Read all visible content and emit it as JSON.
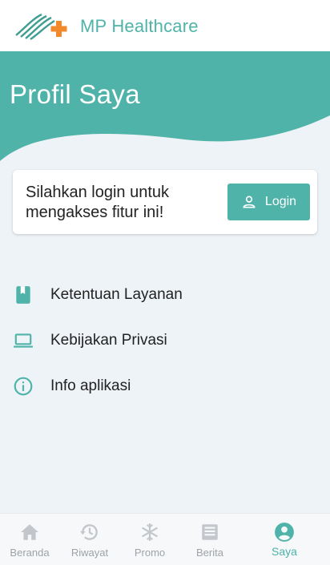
{
  "header": {
    "brand": "MP Healthcare",
    "logo_icon": "mp-healthcare-logo",
    "brand_color": "#4fb3a9",
    "cross_color": "#f28a2b"
  },
  "hero": {
    "title": "Profil Saya",
    "color": "#4fb3a9"
  },
  "login_card": {
    "message": "Silahkan login untuk mengakses fitur ini!",
    "button_label": "Login",
    "button_icon": "user-icon"
  },
  "menu": [
    {
      "label": "Ketentuan Layanan",
      "icon": "book-icon"
    },
    {
      "label": "Kebijakan Privasi",
      "icon": "laptop-icon"
    },
    {
      "label": "Info aplikasi",
      "icon": "info-icon"
    }
  ],
  "bottom_nav": [
    {
      "label": "Beranda",
      "icon": "home-icon",
      "active": false
    },
    {
      "label": "Riwayat",
      "icon": "history-icon",
      "active": false
    },
    {
      "label": "Promo",
      "icon": "snowflake-icon",
      "active": false
    },
    {
      "label": "Berita",
      "icon": "newspaper-icon",
      "active": false
    },
    {
      "label": "Saya",
      "icon": "account-circle-icon",
      "active": true
    }
  ]
}
